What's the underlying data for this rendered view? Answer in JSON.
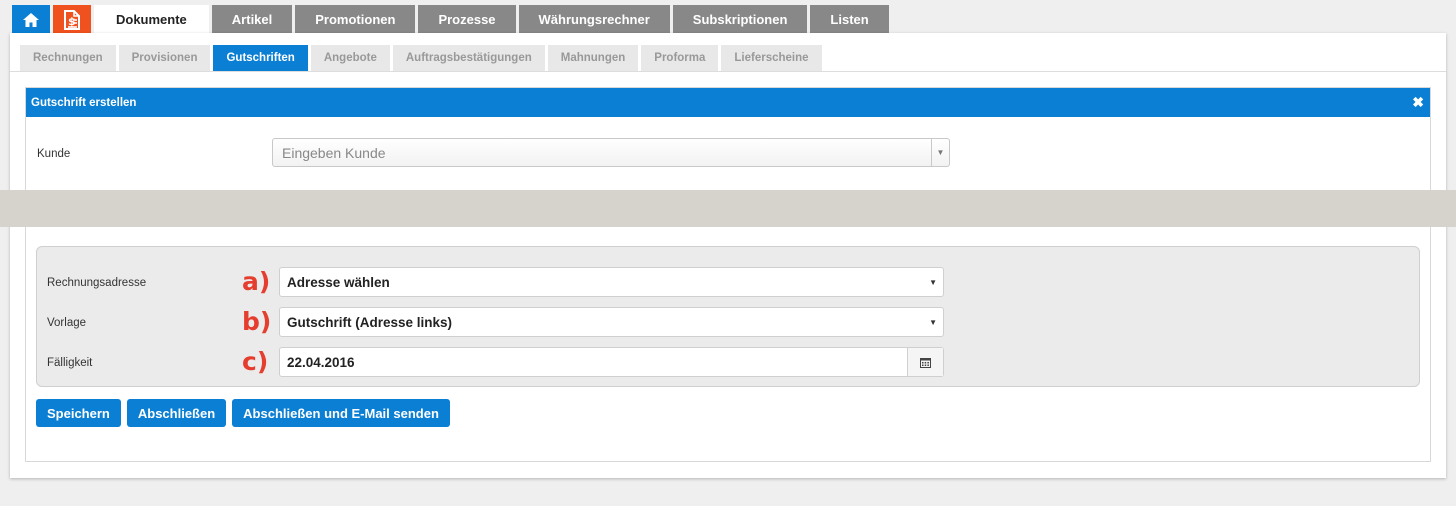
{
  "top_tabs": [
    "Dokumente",
    "Artikel",
    "Promotionen",
    "Prozesse",
    "Währungsrechner",
    "Subskriptionen",
    "Listen"
  ],
  "sub_tabs": [
    "Rechnungen",
    "Provisionen",
    "Gutschriften",
    "Angebote",
    "Auftragsbestätigungen",
    "Mahnungen",
    "Proforma",
    "Lieferscheine"
  ],
  "dialog": {
    "title": "Gutschrift erstellen",
    "close": "✖",
    "kunde_label": "Kunde",
    "kunde_placeholder": "Eingeben Kunde"
  },
  "form": {
    "rechnungsadresse": {
      "marker": "a)",
      "label": "Rechnungsadresse",
      "value": "Adresse wählen"
    },
    "vorlage": {
      "marker": "b)",
      "label": "Vorlage",
      "value": "Gutschrift (Adresse links)"
    },
    "faelligkeit": {
      "marker": "c)",
      "label": "Fälligkeit",
      "value": "22.04.2016"
    }
  },
  "buttons": {
    "save": "Speichern",
    "finish": "Abschließen",
    "finish_email": "Abschließen und E-Mail senden"
  },
  "colors": {
    "primary": "#0b7fd3",
    "orange": "#f0521f",
    "marker": "#e53e2e"
  }
}
